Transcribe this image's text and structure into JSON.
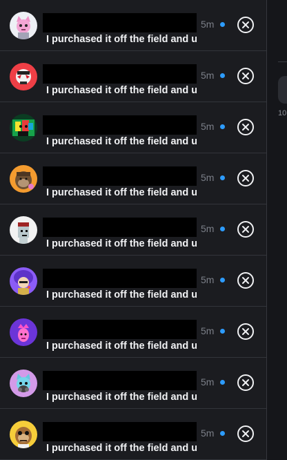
{
  "notifications": {
    "items": [
      {
        "avatar": "pink-cat-avatar",
        "time": "5m",
        "message": "I purchased it off the field and unde"
      },
      {
        "avatar": "red-robot-avatar",
        "time": "5m",
        "message": "I purchased it off the field and u"
      },
      {
        "avatar": "monster-art-avatar",
        "time": "5m",
        "message": "I purchased it off the field and u"
      },
      {
        "avatar": "ape-avatar",
        "time": "5m",
        "message": "I purchased it off the field and u"
      },
      {
        "avatar": "pixel-punk-avatar",
        "time": "5m",
        "message": "I purchased it off the field and u"
      },
      {
        "avatar": "purple-hair-avatar",
        "time": "5m",
        "message": "I purchased it off the field and u"
      },
      {
        "avatar": "purple-bg-character-avatar",
        "time": "5m",
        "message": "I purchased it off the field and u"
      },
      {
        "avatar": "gasmask-cat-avatar",
        "time": "5m",
        "message": "I purchased it off the field and u"
      },
      {
        "avatar": "yellow-ape-avatar",
        "time": "5m",
        "message": "I purchased it off the field and u"
      }
    ]
  },
  "right_panel": {
    "partial_text": "10"
  },
  "colors": {
    "background": "#1b1c20",
    "text": "#f1f2f4",
    "muted": "#7b7f88",
    "accent": "#2d9cff",
    "divider": "#33353b"
  }
}
